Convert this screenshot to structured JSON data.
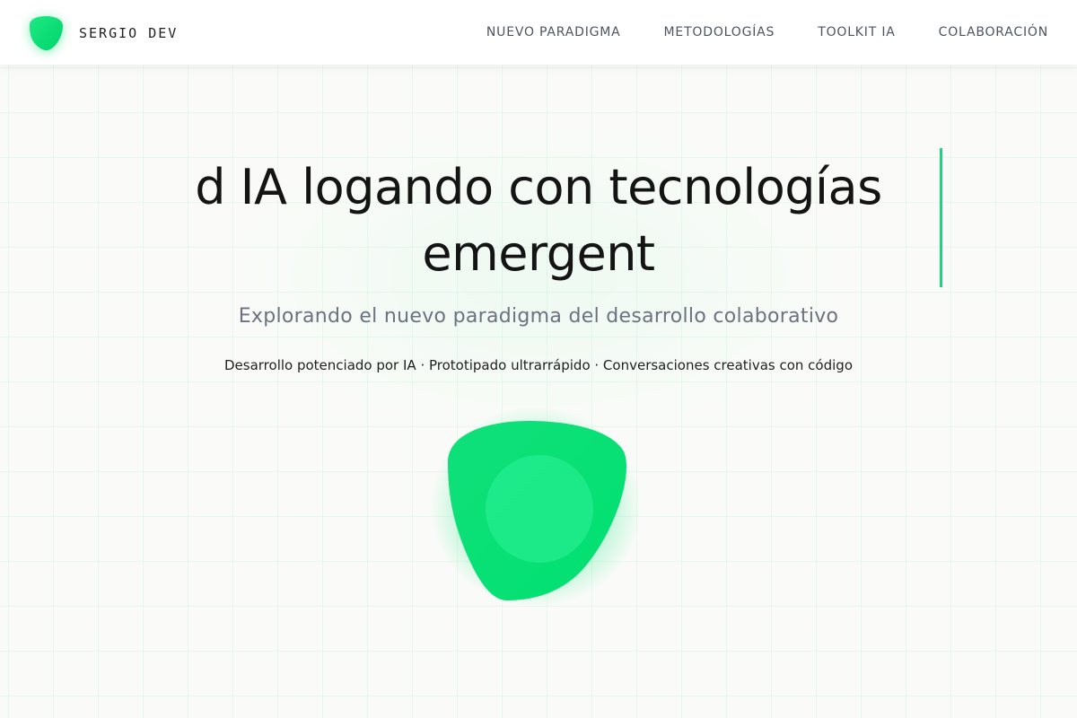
{
  "header": {
    "brand_name": "SERGIO DEV",
    "logo_icon": "green-blob-logo-icon",
    "nav": [
      {
        "label": "NUEVO PARADIGMA"
      },
      {
        "label": "METODOLOGÍAS"
      },
      {
        "label": "TOOLKIT IA"
      },
      {
        "label": "COLABORACIÓN"
      }
    ]
  },
  "hero": {
    "title_line1": "d IA logando con tecnologías",
    "title_line2": "emergent",
    "subtitle": "Explorando el nuevo paradigma del desarrollo colaborativo",
    "tagline": "Desarrollo potenciado por IA · Prototipado ultrarrápido · Conversaciones creativas con código",
    "orb_icon": "green-blob-orb-icon"
  },
  "colors": {
    "accent": "#00e676",
    "accent_dark": "#00d86a",
    "text_dark": "#141414",
    "text_muted": "#6b7280",
    "background": "#fafbf8"
  }
}
